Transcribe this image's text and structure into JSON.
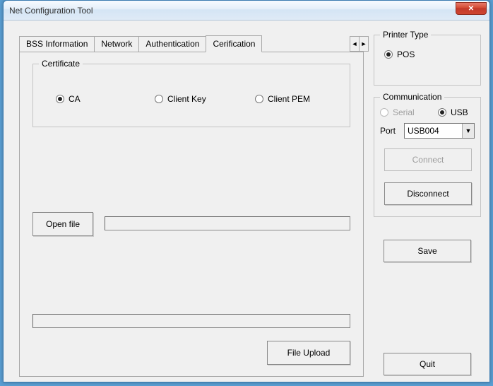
{
  "window": {
    "title": "Net Configuration Tool"
  },
  "tabs": {
    "items": [
      {
        "label": "BSS Information"
      },
      {
        "label": "Network"
      },
      {
        "label": "Authentication"
      },
      {
        "label": "Cerification"
      }
    ],
    "nav_left": "◄",
    "nav_right": "►"
  },
  "certificate": {
    "legend": "Certificate",
    "options": {
      "ca": "CA",
      "client_key": "Client Key",
      "client_pem": "Client PEM"
    },
    "open_file": "Open file",
    "file_upload": "File Upload"
  },
  "printer_type": {
    "legend": "Printer Type",
    "pos": "POS"
  },
  "communication": {
    "legend": "Communication",
    "serial": "Serial",
    "usb": "USB",
    "port_label": "Port",
    "port_value": "USB004",
    "connect": "Connect",
    "disconnect": "Disconnect"
  },
  "actions": {
    "save": "Save",
    "quit": "Quit"
  },
  "close_glyph": "✕"
}
